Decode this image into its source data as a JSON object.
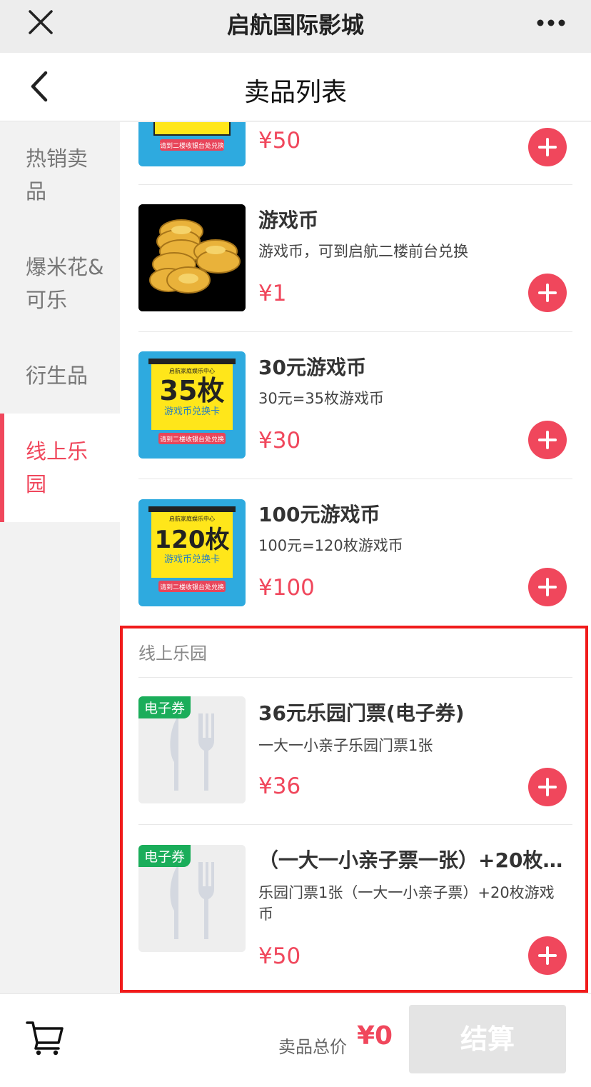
{
  "wx": {
    "title": "启航国际影城"
  },
  "header": {
    "title": "卖品列表"
  },
  "sidebar": {
    "items": [
      {
        "label": "热销卖品"
      },
      {
        "label": "爆米花&可乐"
      },
      {
        "label": "衍生品"
      },
      {
        "label": "线上乐园"
      }
    ],
    "active": "线上乐园"
  },
  "products": [
    {
      "name": "",
      "desc": "",
      "price": "¥50",
      "image": "game-coin-card"
    },
    {
      "name": "游戏币",
      "desc": "游戏币，可到启航二楼前台兑换",
      "price": "¥1",
      "image": "gold-coins"
    },
    {
      "name": "30元游戏币",
      "desc": "30元=35枚游戏币",
      "price": "¥30",
      "image": "game-coin-card",
      "card": {
        "brand": "启航家庭娱乐中心",
        "count": "35枚",
        "subtitle": "游戏币兑换卡",
        "note": "请到二楼收银台处兑换"
      }
    },
    {
      "name": "100元游戏币",
      "desc": "100元=120枚游戏币",
      "price": "¥100",
      "image": "game-coin-card",
      "card": {
        "brand": "启航家庭娱乐中心",
        "count": "120枚",
        "subtitle": "游戏币兑换卡",
        "note": "请到二楼收银台处兑换"
      }
    }
  ],
  "section": {
    "title": "线上乐园"
  },
  "section_products": [
    {
      "tag": "电子券",
      "name": "36元乐园门票(电子券)",
      "desc": "一大一小亲子乐园门票1张",
      "price": "¥36",
      "image": "utensils-placeholder"
    },
    {
      "tag": "电子券",
      "name": "（一大一小亲子票一张）+20枚…",
      "desc": "乐园门票1张（一大一小亲子票）+20枚游戏币",
      "price": "¥50",
      "image": "utensils-placeholder"
    }
  ],
  "top_card": {
    "note": "请到二楼收银台处兑换"
  },
  "bottom": {
    "total_label": "卖品总价",
    "total_value": "¥0",
    "checkout_label": "结算"
  },
  "colors": {
    "accent": "#f0475c",
    "eticket": "#1aad5a",
    "highlight": "#f01b1b"
  }
}
